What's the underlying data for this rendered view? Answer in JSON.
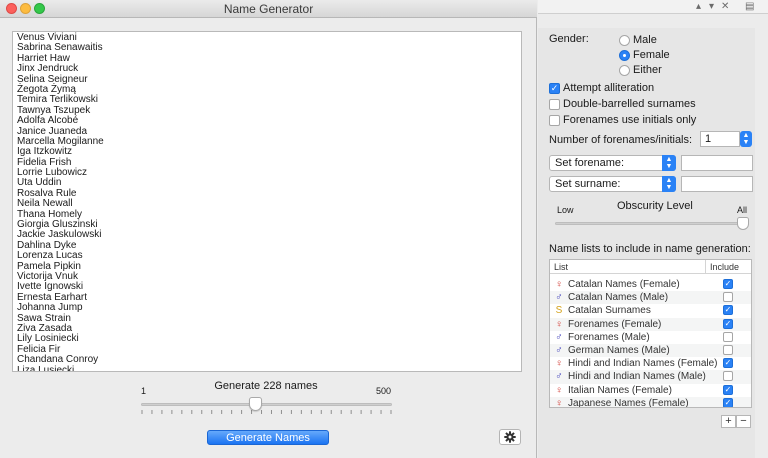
{
  "window": {
    "title": "Name Generator"
  },
  "names": [
    "Venus Viviani",
    "Sabrina Senawaitis",
    "Harriet Haw",
    "Jinx Jendruck",
    "Selina Seigneur",
    "Żegota Żymą",
    "Temira Terlikowski",
    "Tawnya Tszupek",
    "Adolfa Alcobé",
    "Janice Juaneda",
    "Marcella Mogilanne",
    "Iga Itzkowitz",
    "Fidelia Frish",
    "Lorrie Lubowicz",
    "Uta Uddin",
    "Rosalva Rule",
    "Neila Newall",
    "Thana Homely",
    "Giorgia Gluszinski",
    "Jackie Jaskulowski",
    "Dahlina Dyke",
    "Lorenza Lucas",
    "Pamela Pipkin",
    "Victorija Vnuk",
    "Ivette Ignowski",
    "Ernesta Earhart",
    "Johanna Jump",
    "Sawa Strain",
    "Ziva Zasada",
    "Lily Losiniecki",
    "Felicia Fir",
    "Chandana Conroy",
    "Liza Lusiecki"
  ],
  "generate": {
    "label": "Generate 228 names",
    "min_label": "1",
    "max_label": "500",
    "value": 228,
    "min": 1,
    "max": 500,
    "button_label": "Generate Names"
  },
  "options": {
    "gender_label": "Gender:",
    "gender_options": [
      {
        "label": "Male",
        "selected": false
      },
      {
        "label": "Female",
        "selected": true
      },
      {
        "label": "Either",
        "selected": false
      }
    ],
    "checkboxes": [
      {
        "label": "Attempt alliteration",
        "checked": true
      },
      {
        "label": "Double-barrelled surnames",
        "checked": false
      },
      {
        "label": "Forenames use initials only",
        "checked": false
      }
    ],
    "forenames_count_label": "Number of forenames/initials:",
    "forenames_count_value": "1",
    "set_forename": "Set forename:",
    "set_surname": "Set surname:",
    "obscurity_label": "Obscurity Level",
    "obscurity_low": "Low",
    "obscurity_high": "All",
    "obscurity_value": 1.0,
    "lists_label": "Name lists to include in name generation:"
  },
  "name_lists": {
    "col_list": "List",
    "col_include": "Include",
    "rows": [
      {
        "name": "Catalan Names (Female)",
        "kind": "female",
        "include": true
      },
      {
        "name": "Catalan Names (Male)",
        "kind": "male",
        "include": false
      },
      {
        "name": "Catalan Surnames",
        "kind": "surname",
        "include": true
      },
      {
        "name": "Forenames (Female)",
        "kind": "female",
        "include": true
      },
      {
        "name": "Forenames (Male)",
        "kind": "male",
        "include": false
      },
      {
        "name": "German Names (Male)",
        "kind": "male",
        "include": false
      },
      {
        "name": "Hindi and Indian Names (Female)",
        "kind": "female",
        "include": true
      },
      {
        "name": "Hindi and Indian Names (Male)",
        "kind": "male",
        "include": false
      },
      {
        "name": "Italian Names (Female)",
        "kind": "female",
        "include": true
      },
      {
        "name": "Japanese Names (Female)",
        "kind": "female",
        "include": true
      }
    ],
    "add_label": "+",
    "remove_label": "−"
  },
  "colors": {
    "accent": "#2a82f6",
    "female_symbol": "#d0362e",
    "male_symbol": "#3a3ab8",
    "surname_symbol": "#d4a21a"
  },
  "icons": {
    "female": "♀",
    "male": "♂",
    "surname": "S",
    "gear": "gear-icon"
  }
}
